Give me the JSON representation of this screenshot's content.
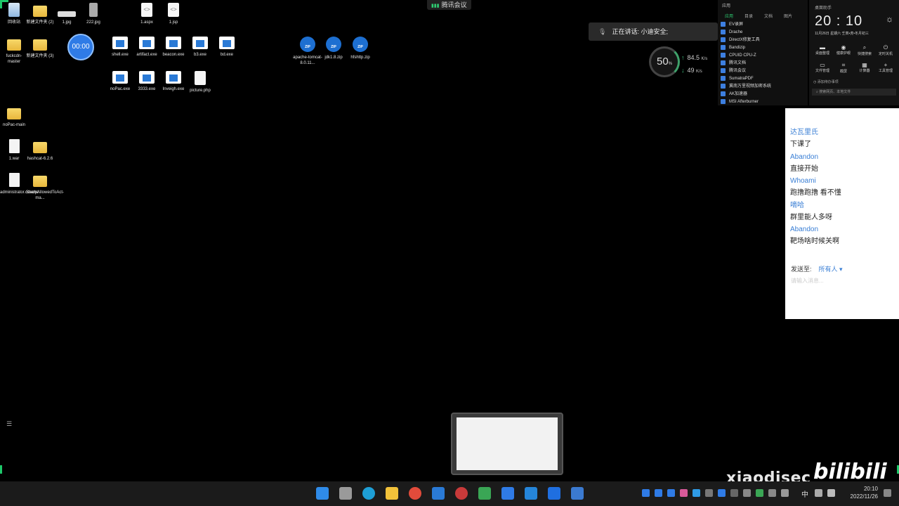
{
  "meeting": {
    "app_name": "腾讯会议",
    "speaking_text": "正在讲话: 小迪安全;",
    "timer": "00:00"
  },
  "desktop_icons": [
    {
      "label": "回收站"
    },
    {
      "label": "新建文件夹 (2)"
    },
    {
      "label": "1.jpg"
    },
    {
      "label": "222.jpg"
    },
    {
      "label": "1.aspx"
    },
    {
      "label": "1.jsp"
    },
    {
      "label": "fuckcdn-master"
    },
    {
      "label": "新建文件夹 (3)"
    },
    {
      "label": "shell.exe"
    },
    {
      "label": "artifact.exe"
    },
    {
      "label": "beacon.exe"
    },
    {
      "label": "b3.exe"
    },
    {
      "label": "bd.exe"
    },
    {
      "label": "apache-tomcat-8.0.11..."
    },
    {
      "label": "jdk1.8.zip"
    },
    {
      "label": "hfshttp.zip"
    },
    {
      "label": "noPac.exe"
    },
    {
      "label": "3333.exe"
    },
    {
      "label": "Inveigh.exe"
    },
    {
      "label": "picture.php"
    },
    {
      "label": "noPac-main"
    },
    {
      "label": "1.war"
    },
    {
      "label": "hashcat-6.2.6"
    },
    {
      "label": "administrator.ccache"
    },
    {
      "label": "SharpAllowedToAct-ma..."
    }
  ],
  "network": {
    "percent": "50",
    "percent_unit": "%",
    "up": "84.5",
    "up_unit": "K/s",
    "down": "49",
    "down_unit": "K/s"
  },
  "app_panel": {
    "header": "应用",
    "tabs": [
      "应用",
      "目录",
      "文档",
      "图片"
    ],
    "items": [
      "EV录屏",
      "Drache",
      "DirectX修复工具",
      "Bandizip",
      "CPUID CPU-Z",
      "腾讯文档",
      "腾讯会议",
      "SumatraPDF",
      "冀南万里视频加密系统",
      "AK加速器",
      "MSI Afterburner"
    ]
  },
  "widget": {
    "header": "桌面助手",
    "time": "20 : 10",
    "date": "11月26日    星期六    壬寅•虎•冬月初三",
    "tools": [
      "桌面整理",
      "健康护眼",
      "快捷搜索",
      "定时关机",
      "文件管理",
      "截屏",
      "计算器",
      "工具管理"
    ],
    "todo": "添加待办事项",
    "search_placeholder": "搜索网页、本地文件"
  },
  "chat": {
    "messages": [
      {
        "name": "达瓦里氏",
        "text": "下课了"
      },
      {
        "name": "Abandon",
        "text": "直接开始"
      },
      {
        "name": "Whoami",
        "text": "跑撸跑撸 看不懂"
      },
      {
        "name": "嘀哈",
        "text": "群里能人多呀"
      },
      {
        "name": "Abandon",
        "text": "靶场啥时候关啊"
      }
    ],
    "send_to_label": "发送至:",
    "send_to_value": "所有人 ▾",
    "input_placeholder": "请输入消息..."
  },
  "watermark": {
    "channel": "xiaodisec",
    "logo": "bilibili"
  },
  "taskbar": {
    "clock_time": "20:10",
    "clock_date": "2022/11/26",
    "ime": "中"
  },
  "colors": {
    "accent_green": "#1ec76a",
    "link_blue": "#3a7fd5",
    "taskbar_bg": "#1b1b1b"
  }
}
